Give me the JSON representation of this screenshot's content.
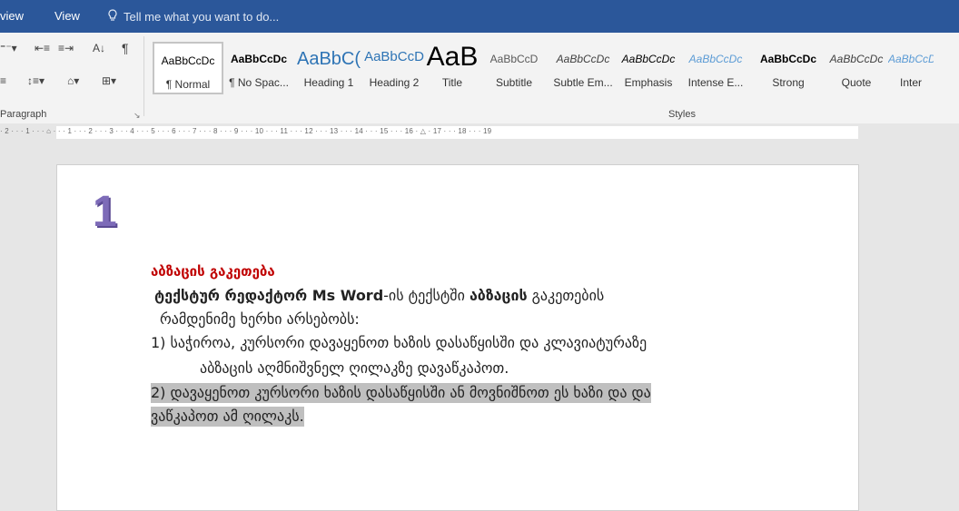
{
  "titlebar": {
    "tabs": [
      "view",
      "View"
    ],
    "tell_me": "Tell me what you want to do..."
  },
  "ribbon": {
    "paragraph_label": "Paragraph",
    "styles_label": "Styles",
    "styles": [
      {
        "preview": "AaBbCcDc",
        "name": "¶ Normal",
        "selected": true
      },
      {
        "preview": "AaBbCcDc",
        "name": "¶ No Spac...",
        "bold": true
      },
      {
        "preview": "AaBbC(",
        "name": "Heading 1",
        "color": "#2e74b5",
        "size": 20
      },
      {
        "preview": "AaBbCcD",
        "name": "Heading 2",
        "color": "#2e74b5",
        "size": 15
      },
      {
        "preview": "AaB",
        "name": "Title",
        "size": 30
      },
      {
        "preview": "AaBbCcD",
        "name": "Subtitle",
        "color": "#595959"
      },
      {
        "preview": "AaBbCcDc",
        "name": "Subtle Em...",
        "italic": true,
        "color": "#404040"
      },
      {
        "preview": "AaBbCcDc",
        "name": "Emphasis",
        "italic": true
      },
      {
        "preview": "AaBbCcDc",
        "name": "Intense E...",
        "italic": true,
        "color": "#5b9bd5"
      },
      {
        "preview": "AaBbCcDc",
        "name": "Strong",
        "bold": true
      },
      {
        "preview": "AaBbCcDc",
        "name": "Quote",
        "italic": true,
        "color": "#404040"
      },
      {
        "preview": "AaBbCcDc",
        "name": "Inter",
        "italic": true,
        "color": "#5b9bd5"
      }
    ]
  },
  "ruler": {
    "text": "· 2 · · · 1 · · · ⌂ · · · 1 · · · 2 · · · 3 · · · 4 · · · 5 · · · 6 · · · 7 · · · 8 · · · 9 · · · 10 · · · 11 · · · 12 · · · 13 · · · 14 · · · 15 · · · 16 · △ · 17 · · · 18 · · · 19"
  },
  "document": {
    "number": "1",
    "heading": "აბზაცის გაკეთება",
    "line1_bold": "ტექსტურ რედაქტორ Ms Word",
    "line1_rest": "-ის ტექსტში ",
    "line1_bold2": "აბზაცის",
    "line1_end": " გაკეთების",
    "line2": "რამდენიმე ხერხი არსებობს:",
    "line3": "1) საჭიროა, კურსორი დავაყენოთ ხაზის დასაწყისში და კლავიატურაზე",
    "line4": "აბზაცის აღმნიშვნელ  ღილაკზე  დავაწკაპოთ.",
    "line5": "2) დავაყენოთ კურსორი ხაზის დასაწყისში ან მოვნიშნოთ ეს ხაზი და  და",
    "line6": "ვაწკაპოთ ამ ღილაკს."
  },
  "colors": {
    "heading": "#c00000",
    "ribbon_blue": "#2b579a",
    "highlight": "#bfbfbf"
  }
}
